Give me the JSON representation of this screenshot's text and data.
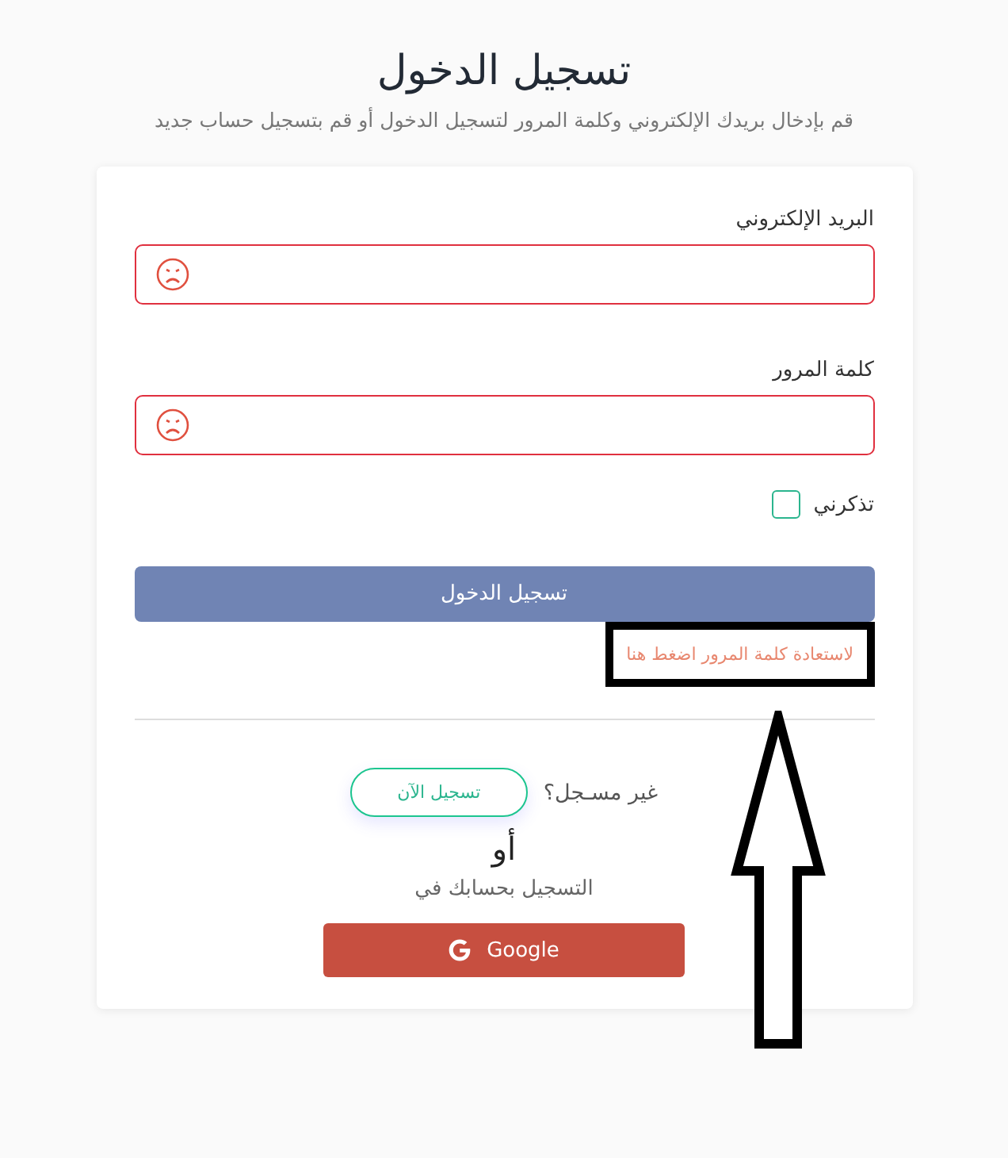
{
  "page": {
    "title": "تسجيل الدخول",
    "subtitle": "قم بإدخال بريدك الإلكتروني وكلمة المرور لتسجيل الدخول أو قم بتسجيل حساب جديد"
  },
  "form": {
    "fields": [
      {
        "label": "البريد الإلكتروني",
        "invalid": true
      },
      {
        "label": "كلمة المرور",
        "invalid": true
      }
    ],
    "remember": {
      "label": "تذكرني",
      "checked": false
    },
    "submit": "تسجيل الدخول",
    "forgot_link": {
      "label": "لاستعادة كلمة المرور اضغط هنا",
      "highlighted": true
    },
    "register": {
      "prompt": "غير مسـجل؟",
      "button": "تسجيل الآن"
    },
    "or_text": "أو",
    "social_prompt": "التسجيل بحسابك في",
    "google_button": "Google"
  }
}
